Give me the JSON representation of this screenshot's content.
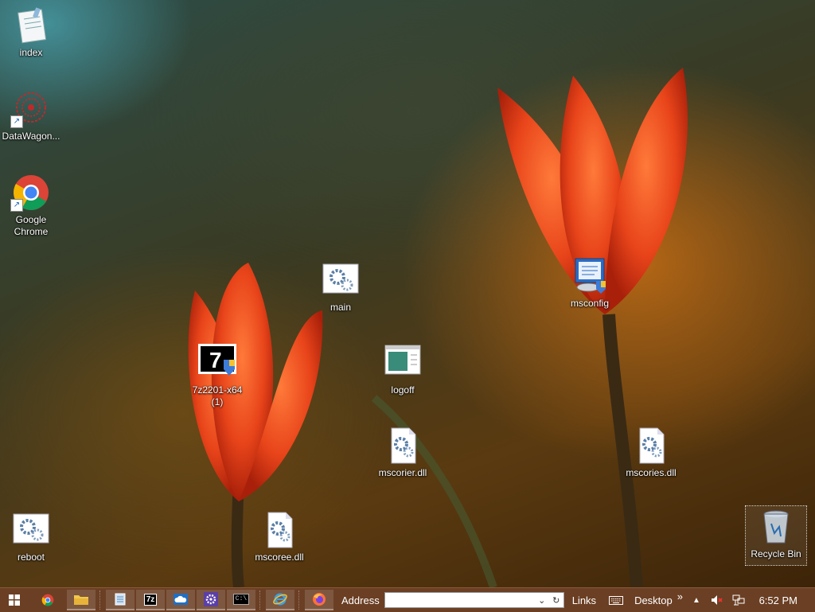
{
  "desktop": {
    "icons": {
      "index": "index",
      "datawagon": "DataWagon...",
      "chrome": "Google Chrome",
      "main": "main",
      "msconfig": "msconfig",
      "zip": "7z2201-x64 (1)",
      "logoff": "logoff",
      "mscorier": "mscorier.dll",
      "mscories": "mscories.dll",
      "reboot": "reboot",
      "mscoree": "mscoree.dll",
      "recycle": "Recycle Bin"
    }
  },
  "taskbar": {
    "address_label": "Address",
    "address_value": "",
    "links_label": "Links",
    "desktop_label": "Desktop",
    "overflow_glyph": "»",
    "clock": "6:52 PM",
    "apps": [
      "start-icon",
      "chrome-icon",
      "file-explorer-icon",
      "notepad-icon",
      "7zip-icon",
      "onedrive-icon",
      "settings-icon",
      "cmd-icon",
      "internet-explorer-icon",
      "firefox-icon"
    ],
    "zip_glyph": "7z",
    "cmd_glyph": "C:\\"
  },
  "colors": {
    "taskbar_bg": "#6b3f24",
    "tulip": "#e8441a",
    "accent_blue": "#1a5fb4"
  }
}
